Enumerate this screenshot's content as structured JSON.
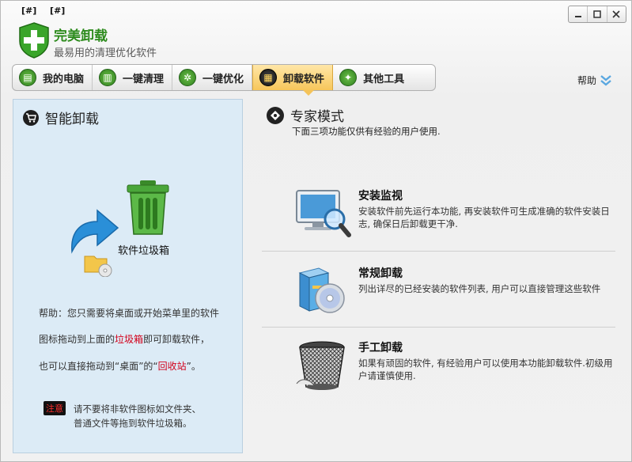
{
  "window": {
    "top_tags": [
      "[#]",
      "[#]"
    ],
    "controls": [
      "□",
      "□",
      "✕"
    ]
  },
  "brand": {
    "title": "完美卸载",
    "subtitle": "最易用的清理优化软件"
  },
  "tabs": [
    {
      "label": "我的电脑",
      "icon": "computer-icon"
    },
    {
      "label": "一键清理",
      "icon": "trash-icon"
    },
    {
      "label": "一键优化",
      "icon": "gears-icon"
    },
    {
      "label": "卸载软件",
      "icon": "uninstall-icon",
      "active": true
    },
    {
      "label": "其他工具",
      "icon": "tools-icon"
    }
  ],
  "help_label": "帮助",
  "left_panel": {
    "title": "智能卸载",
    "trash_label": "软件垃圾箱",
    "help_line1": "帮助：您只需要将桌面或开始菜单里的软件",
    "help_line2_a": "图标拖动到上面的",
    "help_line2_red": "垃圾箱",
    "help_line2_b": "即可卸载软件，",
    "help_line3_a": "也可以直接拖动到“桌面”的“",
    "help_line3_red": "回收站",
    "help_line3_b": "”。",
    "note_badge": "注意",
    "note_line1": "请不要将非软件图标如文件夹、",
    "note_line2": "普通文件等拖到软件垃圾箱。"
  },
  "expert": {
    "title": "专家模式",
    "desc": "下面三项功能仅供有经验的用户使用."
  },
  "features": [
    {
      "title": "安装监视",
      "desc": "安装软件前先运行本功能, 再安装软件可生成准确的软件安装日志, 确保日后卸载更干净."
    },
    {
      "title": "常规卸载",
      "desc": "列出详尽的已经安装的软件列表, 用户可以直接管理这些软件"
    },
    {
      "title": "手工卸载",
      "desc": "如果有顽固的软件, 有经验用户可以使用本功能卸载软件.初级用户请谨慎使用."
    }
  ],
  "colors": {
    "brand_green": "#2d8b1d",
    "active_tab": "#f7c65a",
    "left_panel_bg": "#dcebf6",
    "highlight_red": "#d2001a"
  }
}
